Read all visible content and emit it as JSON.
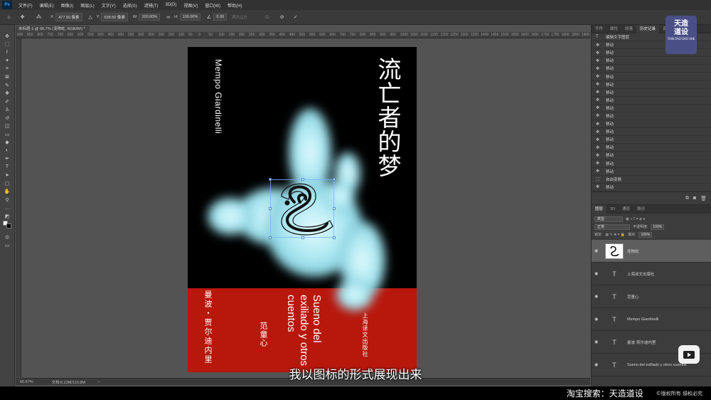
{
  "menu": {
    "logo": "Ps",
    "items": [
      "文件(F)",
      "编辑(E)",
      "图像(I)",
      "图层(L)",
      "文字(Y)",
      "选择(S)",
      "滤镜(T)",
      "3D(D)",
      "视图(V)",
      "窗口(W)",
      "帮助(H)"
    ]
  },
  "options": {
    "x_label": "X:",
    "x_value": "477.50 像素",
    "y_label": "Y:",
    "y_value": "638.50 像素",
    "w_label": "W:",
    "w_value": "100.00%",
    "h_label": "H:",
    "h_value": "100.00%",
    "angle_value": "0.00",
    "interp_label": "两次立方"
  },
  "document": {
    "tab_title": "未标题-1 @ 66.7% (宠物蛇, RGB/8#) *",
    "zoom": "66.67%",
    "doc_size": "文档:6.22M/110.8M"
  },
  "ruler": {
    "top_ticks": [
      "900",
      "850",
      "800",
      "750",
      "700",
      "650",
      "600",
      "550",
      "500",
      "450",
      "400",
      "350",
      "300",
      "250",
      "200",
      "150",
      "100",
      "50",
      "0",
      "50",
      "100",
      "150",
      "200",
      "250",
      "300",
      "350",
      "400",
      "450",
      "500",
      "550",
      "600",
      "650",
      "700",
      "750",
      "800",
      "850",
      "900",
      "950",
      "1000",
      "1050",
      "1100",
      "1150",
      "1200",
      "1250",
      "1300",
      "1350",
      "1400",
      "1450",
      "1500",
      "1550",
      "1600",
      "1650",
      "1700",
      "1750",
      "1800",
      "1850",
      "1900"
    ]
  },
  "poster": {
    "title_zh": "流亡者的梦",
    "author_en": "Mempo Giardinelli",
    "author_zh": "曼波・贾尔迪内里",
    "translator": "范童心",
    "title_es": "Sueno del exiliado y otros cuentos",
    "publisher": "上海译文出版社",
    "colors": {
      "top": "#000000",
      "bottom": "#b8170c",
      "hand": "#a8e6f0"
    }
  },
  "history": {
    "tabs": [
      "字符",
      "属性",
      "段落",
      "历史记录",
      "调整"
    ],
    "active_tab": "历史记录",
    "rows": [
      {
        "label": "编辑文字图层",
        "icon": "text-icon"
      },
      {
        "label": "移动",
        "icon": "move-icon"
      },
      {
        "label": "移动",
        "icon": "move-icon"
      },
      {
        "label": "移动",
        "icon": "move-icon"
      },
      {
        "label": "移动",
        "icon": "move-icon"
      },
      {
        "label": "移动",
        "icon": "move-icon"
      },
      {
        "label": "移动",
        "icon": "move-icon"
      },
      {
        "label": "移动",
        "icon": "move-icon"
      },
      {
        "label": "移动",
        "icon": "move-icon"
      },
      {
        "label": "移动",
        "icon": "move-icon"
      },
      {
        "label": "移动",
        "icon": "move-icon"
      },
      {
        "label": "移动",
        "icon": "move-icon"
      },
      {
        "label": "移动",
        "icon": "move-icon"
      },
      {
        "label": "移动",
        "icon": "move-icon"
      },
      {
        "label": "移动",
        "icon": "move-icon"
      },
      {
        "label": "移动",
        "icon": "move-icon"
      },
      {
        "label": "移动",
        "icon": "move-icon"
      },
      {
        "label": "移动",
        "icon": "move-icon"
      },
      {
        "label": "自由变换",
        "icon": "transform-icon"
      },
      {
        "label": "移动",
        "icon": "move-icon"
      },
      {
        "label": "移动",
        "icon": "move-icon"
      }
    ]
  },
  "layers": {
    "tabs": [
      "图层",
      "3D",
      "通道",
      "路径"
    ],
    "active_tab": "图层",
    "filter_label": "类型",
    "blend_mode": "正常",
    "opacity_label": "不透明度:",
    "opacity_value": "100%",
    "lock_label": "锁定:",
    "fill_label": "填充:",
    "fill_value": "100%",
    "items": [
      {
        "name": "宠物蛇",
        "kind": "image"
      },
      {
        "name": "上海译文出版社",
        "kind": "text"
      },
      {
        "name": "范童心",
        "kind": "text"
      },
      {
        "name": "Mempo Giardinelli",
        "kind": "text"
      },
      {
        "name": "曼波·贾尔迪内里",
        "kind": "text"
      },
      {
        "name": "Sueno del  exiliado y  otros cuentos",
        "kind": "text"
      }
    ]
  },
  "watermark": {
    "line1": "天造",
    "line2": "道设",
    "small": "TIAN ZAO\nDAO SHE"
  },
  "subtitle": "我以图标的形式展现出来",
  "banner": {
    "main": "淘宝搜索：天造道设",
    "copyright": "©版权所有 侵权必究"
  }
}
